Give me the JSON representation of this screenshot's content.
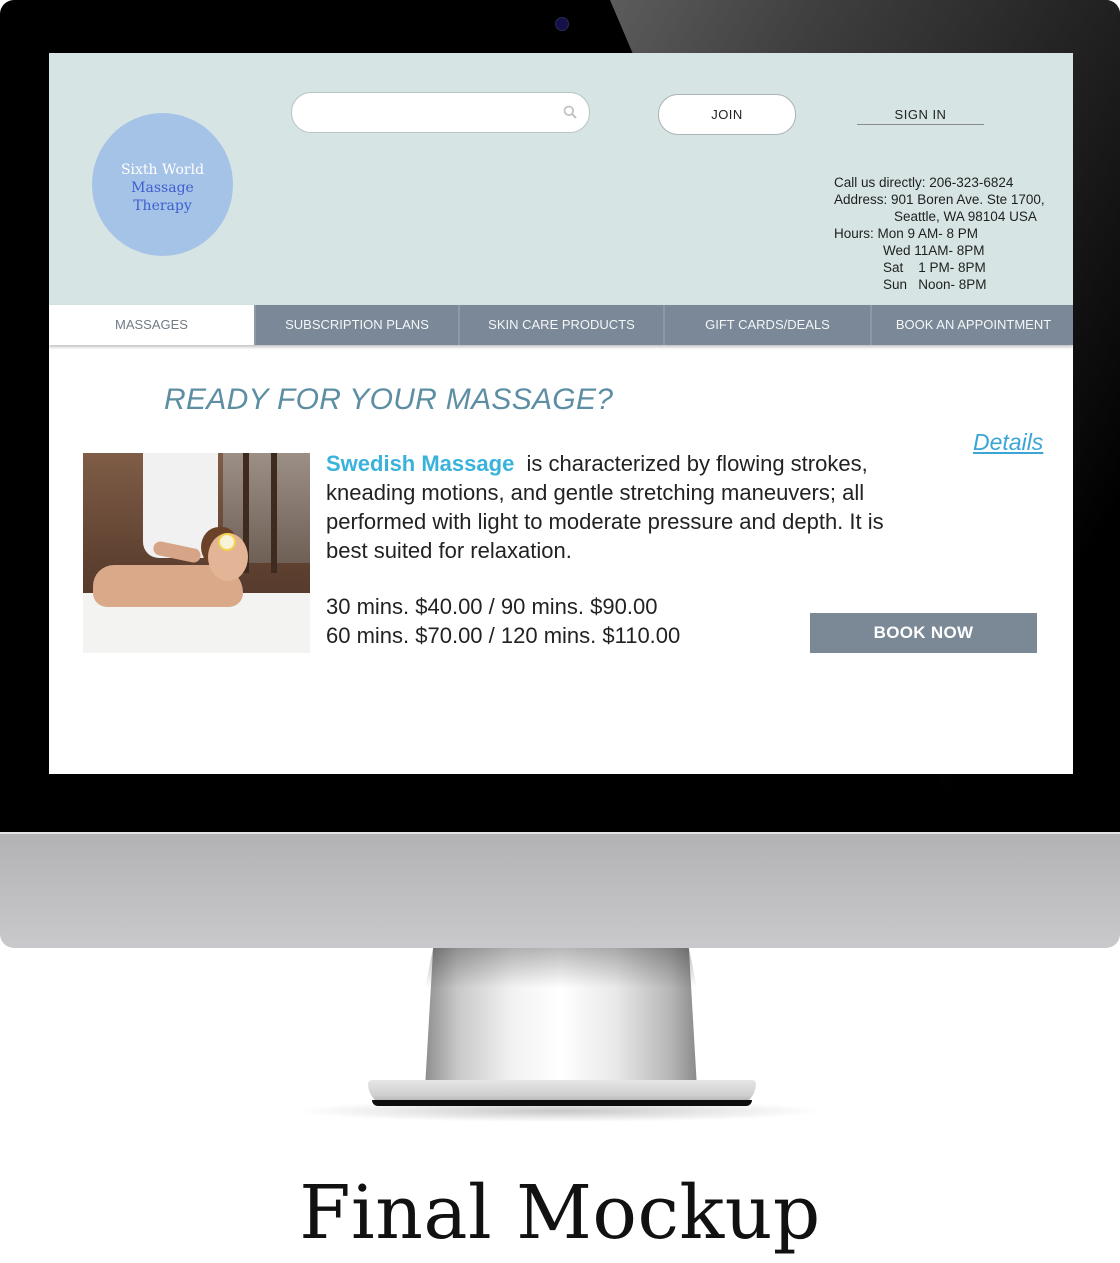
{
  "site": {
    "logo_line1": "Sixth World",
    "logo_line2": "Massage",
    "logo_line3": "Therapy",
    "search_placeholder": "",
    "join_label": "JOIN",
    "signin_label": "SIGN IN"
  },
  "contact": {
    "phone": "Call us directly: 206-323-6824",
    "address1": "Address: 901 Boren Ave. Ste 1700,",
    "address2": "Seattle, WA 98104 USA",
    "hours1": "Hours: Mon 9 AM- 8 PM",
    "hours2": "Wed 11AM- 8PM",
    "hours3": "Sat    1 PM- 8PM",
    "hours4": "Sun   Noon- 8PM"
  },
  "nav": {
    "tabs": [
      {
        "label": "MASSAGES",
        "active": true
      },
      {
        "label": "SUBSCRIPTION PLANS",
        "active": false
      },
      {
        "label": "SKIN CARE PRODUCTS",
        "active": false
      },
      {
        "label": "GIFT CARDS/DEALS",
        "active": false
      },
      {
        "label": "BOOK AN APPOINTMENT",
        "active": false
      }
    ]
  },
  "main": {
    "headline": "READY FOR YOUR MASSAGE?",
    "details_link": "Details",
    "massage_name": "Swedish Massage",
    "description": "is characterized by flowing strokes, kneading motions, and gentle stretching maneuvers; all performed with light to moderate pressure and depth. It is best suited for relaxation.",
    "price_line1": "30 mins. $40.00  /  90 mins. $90.00",
    "price_line2": "60 mins. $70.00  /  120 mins. $110.00",
    "book_label": "BOOK NOW"
  },
  "caption": "Final Mockup",
  "colors": {
    "header_bg": "#d6e5e4",
    "nav_bg": "#7a8897",
    "accent": "#3ab3dc",
    "headline": "#5d8ea3",
    "logo_circle": "#a5c3e6"
  },
  "icons": [
    "search-icon"
  ]
}
